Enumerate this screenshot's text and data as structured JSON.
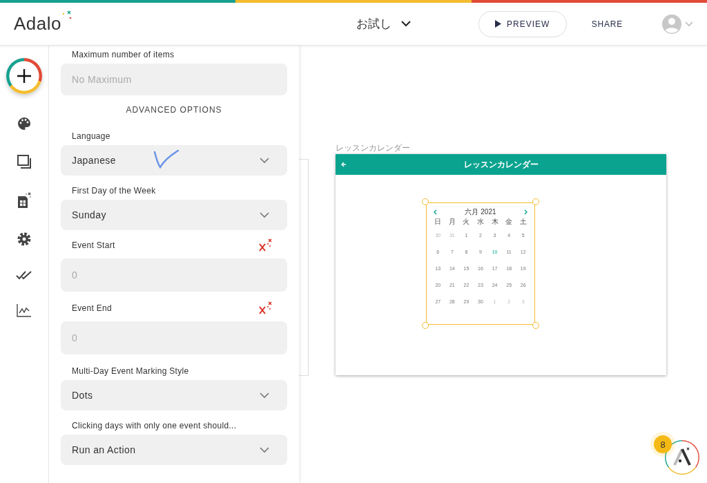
{
  "header": {
    "logo": "Adalo",
    "app_name": "お試し",
    "preview": "PREVIEW",
    "share": "SHARE"
  },
  "panel": {
    "fields": [
      {
        "kind": "input",
        "label": "Maximum number of items",
        "placeholder": "No Maximum"
      },
      {
        "kind": "section",
        "label": "ADVANCED OPTIONS"
      },
      {
        "kind": "select",
        "label": "Language",
        "value": "Japanese",
        "annotated": true
      },
      {
        "kind": "select",
        "label": "First Day of the Week",
        "value": "Sunday",
        "annotated": false
      },
      {
        "kind": "input",
        "label": "Event Start",
        "placeholder": "0",
        "magic": true
      },
      {
        "kind": "input",
        "label": "Event End",
        "placeholder": "0",
        "magic": true
      },
      {
        "kind": "select",
        "label": "Multi-Day Event Marking Style",
        "value": "Dots",
        "annotated": false
      },
      {
        "kind": "select",
        "label": "Clicking days with only one event should...",
        "value": "Run an Action",
        "annotated": false
      }
    ]
  },
  "canvas": {
    "screen_name": "レッスンカレンダー",
    "screen_title": "レッスンカレンダー",
    "calendar": {
      "month": "六月 2021",
      "weekdays": [
        "日",
        "月",
        "火",
        "水",
        "木",
        "金",
        "土"
      ],
      "weeks": [
        [
          {
            "d": "30",
            "in_month": false,
            "today": false
          },
          {
            "d": "31",
            "in_month": false,
            "today": false
          },
          {
            "d": "1",
            "in_month": true,
            "today": false
          },
          {
            "d": "2",
            "in_month": true,
            "today": false
          },
          {
            "d": "3",
            "in_month": true,
            "today": false
          },
          {
            "d": "4",
            "in_month": true,
            "today": false
          },
          {
            "d": "5",
            "in_month": true,
            "today": false
          }
        ],
        [
          {
            "d": "6",
            "in_month": true,
            "today": false
          },
          {
            "d": "7",
            "in_month": true,
            "today": false
          },
          {
            "d": "8",
            "in_month": true,
            "today": false
          },
          {
            "d": "9",
            "in_month": true,
            "today": false
          },
          {
            "d": "10",
            "in_month": true,
            "today": true
          },
          {
            "d": "11",
            "in_month": true,
            "today": false
          },
          {
            "d": "12",
            "in_month": true,
            "today": false
          }
        ],
        [
          {
            "d": "13",
            "in_month": true,
            "today": false
          },
          {
            "d": "14",
            "in_month": true,
            "today": false
          },
          {
            "d": "15",
            "in_month": true,
            "today": false
          },
          {
            "d": "16",
            "in_month": true,
            "today": false
          },
          {
            "d": "17",
            "in_month": true,
            "today": false
          },
          {
            "d": "18",
            "in_month": true,
            "today": false
          },
          {
            "d": "19",
            "in_month": true,
            "today": false
          }
        ],
        [
          {
            "d": "20",
            "in_month": true,
            "today": false
          },
          {
            "d": "21",
            "in_month": true,
            "today": false
          },
          {
            "d": "22",
            "in_month": true,
            "today": false
          },
          {
            "d": "23",
            "in_month": true,
            "today": false
          },
          {
            "d": "24",
            "in_month": true,
            "today": false
          },
          {
            "d": "25",
            "in_month": true,
            "today": false
          },
          {
            "d": "26",
            "in_month": true,
            "today": false
          }
        ],
        [
          {
            "d": "27",
            "in_month": true,
            "today": false
          },
          {
            "d": "28",
            "in_month": true,
            "today": false
          },
          {
            "d": "29",
            "in_month": true,
            "today": false
          },
          {
            "d": "30",
            "in_month": true,
            "today": false
          },
          {
            "d": "1",
            "in_month": false,
            "today": false
          },
          {
            "d": "2",
            "in_month": false,
            "today": false
          },
          {
            "d": "3",
            "in_month": false,
            "today": false
          }
        ]
      ]
    }
  },
  "notification_badge": "8"
}
